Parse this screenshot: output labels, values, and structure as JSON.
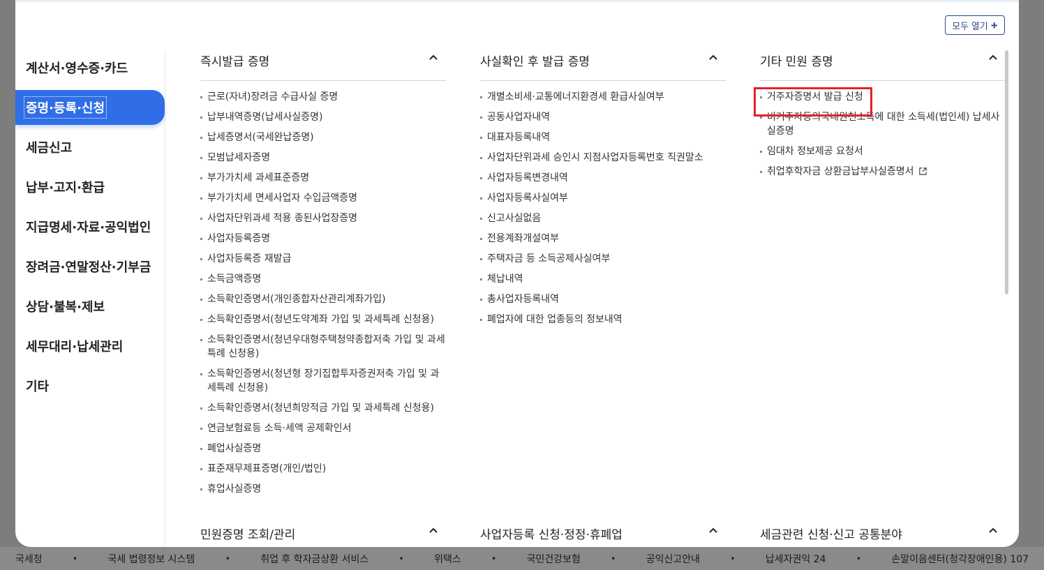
{
  "header": {
    "expand_all_label": "모두 열기"
  },
  "sidebar": {
    "items": [
      {
        "label": "계산서·영수증·카드"
      },
      {
        "label": "증명·등록·신청"
      },
      {
        "label": "세금신고"
      },
      {
        "label": "납부·고지·환급"
      },
      {
        "label": "지급명세·자료·공익법인"
      },
      {
        "label": "장려금·연말정산·기부금"
      },
      {
        "label": "상담·불복·제보"
      },
      {
        "label": "세무대리·납세관리"
      },
      {
        "label": "기타"
      }
    ]
  },
  "sections": [
    {
      "title": "즉시발급 증명",
      "items": [
        "근로(자녀)장려금 수급사실 증명",
        "납부내역증명(납세사실증명)",
        "납세증명서(국세완납증명)",
        "모범납세자증명",
        "부가가치세 과세표준증명",
        "부가가치세 면세사업자 수입금액증명",
        "사업자단위과세 적용 종된사업장증명",
        "사업자등록증명",
        "사업자등록증 재발급",
        "소득금액증명",
        "소득확인증명서(개인종합자산관리계좌가입)",
        "소득확인증명서(청년도약계좌 가입 및 과세특례 신청용)",
        "소득확인증명서(청년우대형주택청약종합저축 가입 및 과세특례 신청용)",
        "소득확인증명서(청년형 장기집합투자증권저축 가입 및 과세특례 신청용)",
        "소득확인증명서(청년희망적금 가입 및 과세특례 신청용)",
        "연금보험료등 소득·세액 공제확인서",
        "폐업사실증명",
        "표준재무제표증명(개인/법인)",
        "휴업사실증명"
      ]
    },
    {
      "title": "사실확인 후 발급 증명",
      "items": [
        "개별소비세·교통에너지환경세 환급사실여부",
        "공동사업자내역",
        "대표자등록내역",
        "사업자단위과세 승인시 지점사업자등록번호 직권말소",
        "사업자등록변경내역",
        "사업자등록사실여부",
        "신고사실없음",
        "전용계좌개설여부",
        "주택자금 등 소득공제사실여부",
        "체납내역",
        "총사업자등록내역",
        "폐업자에 대한 업종등의 정보내역"
      ]
    },
    {
      "title": "기타 민원 증명",
      "items": [
        "거주자증명서 발급 신청",
        "비거주자등의국내원천소득에 대한 소득세(법인세) 납세사실증명",
        "임대차 정보제공 요청서",
        "취업후학자금 상환금납부사실증명서"
      ]
    }
  ],
  "bottom_sections": [
    {
      "title": "민원증명 조회/관리"
    },
    {
      "title": "사업자등록 신청·정정·휴폐업"
    },
    {
      "title": "세금관련 신청·신고 공통분야"
    }
  ],
  "footer": {
    "links": [
      "국세청",
      "국세 법령정보 시스템",
      "취업 후 학자금상환 서비스",
      "위택스",
      "국민건강보험",
      "공익신고안내",
      "납세자권익 24",
      "손말이음센터(청각장애인용) 107"
    ],
    "separator": "•"
  },
  "colors": {
    "active_tab": "#2f6ee6",
    "highlight_box": "#e8202a",
    "button_border": "#2b4a8c"
  }
}
